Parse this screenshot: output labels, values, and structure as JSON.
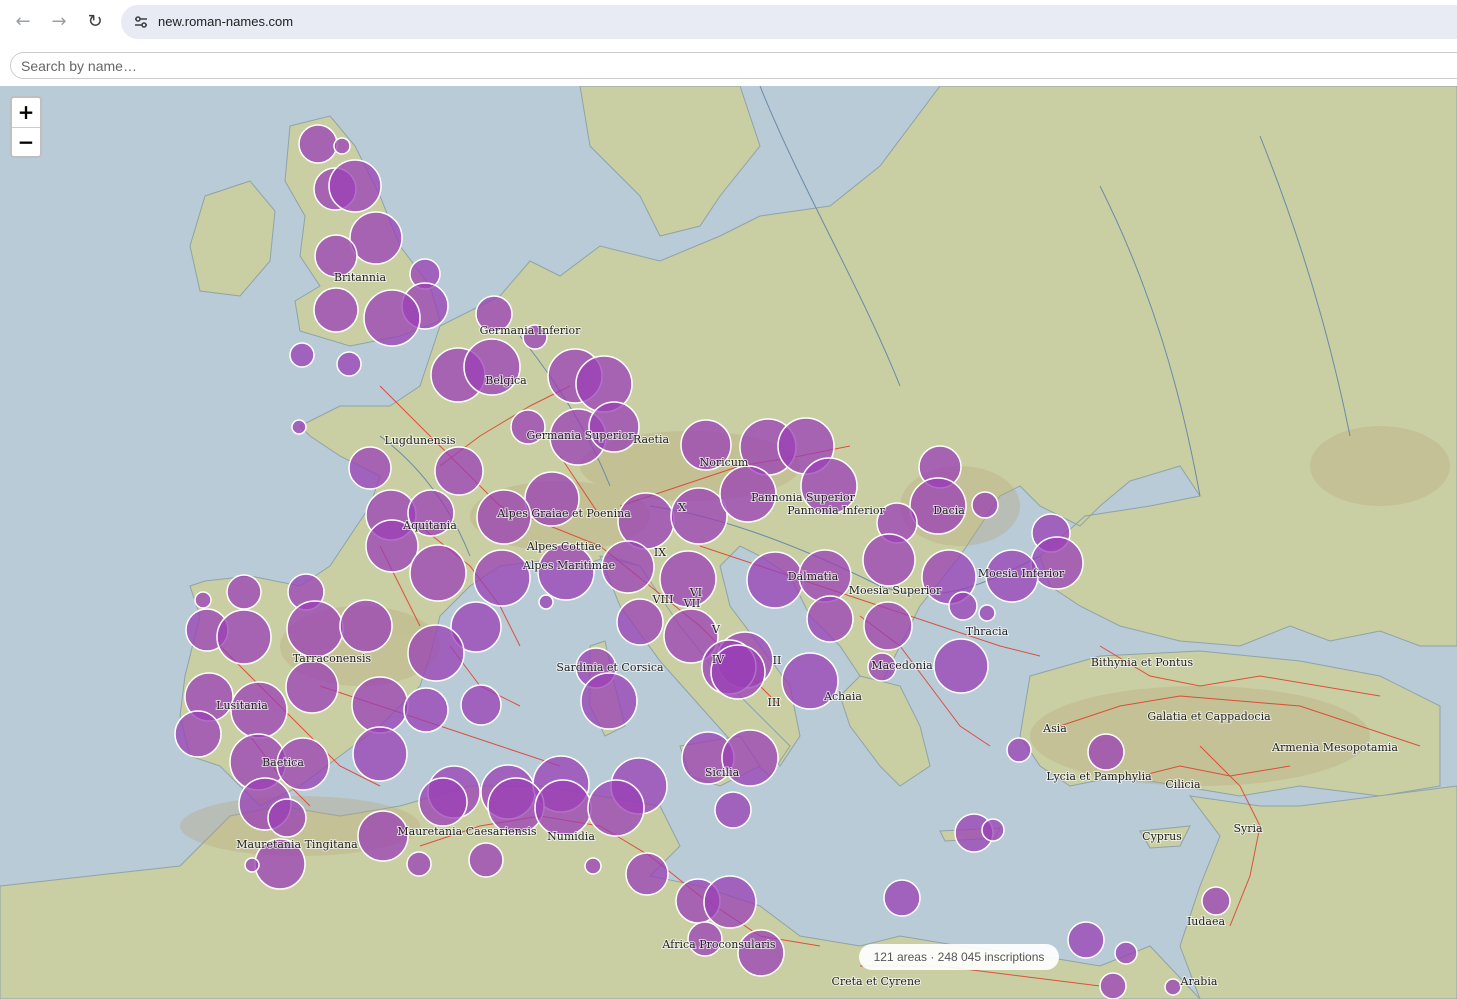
{
  "browser": {
    "url": "new.roman-names.com",
    "back_icon": "arrow-left-icon",
    "forward_icon": "arrow-right-icon",
    "reload_icon": "reload-icon",
    "site_info_icon": "tune-icon"
  },
  "search": {
    "placeholder": "Search by name…",
    "value": ""
  },
  "zoom": {
    "in_label": "+",
    "out_label": "−"
  },
  "status": {
    "text": "121 areas · 248 045 inscriptions"
  },
  "colors": {
    "marker_fill": "#9a3fb5",
    "marker_stroke": "#ffffff",
    "sea": "#b9cbd6",
    "land": "#c8cfa2",
    "roads": "#e03a2a"
  },
  "map": {
    "region_labels": [
      "Britannia",
      "Germania Inferior",
      "Belgica",
      "Lugdunensis",
      "Germania Superior",
      "Raetia",
      "Noricum",
      "Aquitania",
      "Alpes Graiae et Poenina",
      "X",
      "Pannonia Superior",
      "Pannonia Inferior",
      "Dacia",
      "Alpes Cottiae",
      "Alpes Maritimae",
      "IX",
      "VIII",
      "Dalmatia",
      "Moesia Inferior",
      "Moesia Superior",
      "VII",
      "VI",
      "V",
      "Tarraconensis",
      "Sardinia et Corsica",
      "IV",
      "Thracia",
      "Lusitania",
      "Macedonia",
      "II",
      "Achaia",
      "III",
      "Bithynia et Pontus",
      "Galatia et Cappadocia",
      "Asia",
      "Armenia Mesopotamia",
      "Baetica",
      "Sicilia",
      "Lycia et Pamphylia",
      "Cilicia",
      "Mauretania Caesariensis",
      "Numidia",
      "Mauretania Tingitana",
      "Cyprus",
      "Syria",
      "Iudaea",
      "Africa Proconsularis",
      "Creta et Cyrene",
      "Arabia"
    ]
  }
}
